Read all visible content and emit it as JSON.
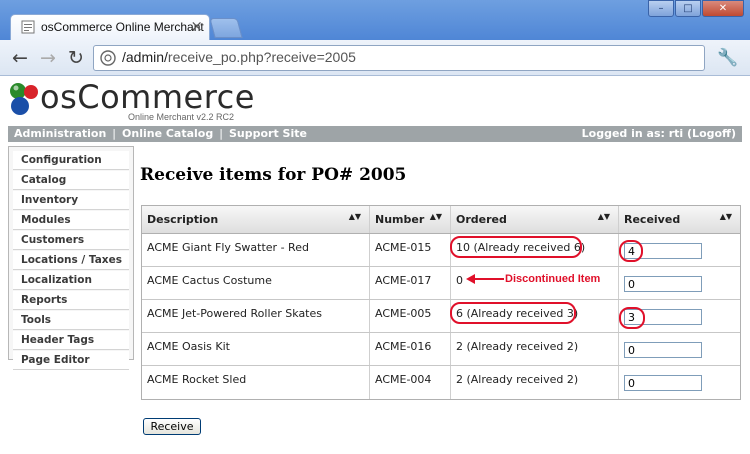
{
  "browser": {
    "tab_title": "osCommerce Online Merchant",
    "tab_close": "×",
    "url_prefix": "/admin/",
    "url_rest": "receive_po.php?receive=2005",
    "window_buttons": [
      "–",
      "□",
      "✕"
    ]
  },
  "header": {
    "brand": "osCommerce",
    "subtitle": "Online Merchant v2.2 RC2",
    "nav_links": [
      "Administration",
      "Online Catalog",
      "Support Site"
    ],
    "nav_separator": "|",
    "login_text": "Logged in as: rti (Logoff)"
  },
  "sidebar": {
    "items": [
      "Configuration",
      "Catalog",
      "Inventory",
      "Modules",
      "Customers",
      "Locations / Taxes",
      "Localization",
      "Reports",
      "Tools",
      "Header Tags",
      "Page Editor"
    ]
  },
  "main": {
    "title": "Receive items for PO# 2005",
    "columns": [
      "Description",
      "Number",
      "Ordered",
      "Received"
    ],
    "sort_glyph": "▲▼",
    "rows": [
      {
        "description": "ACME Giant Fly Swatter - Red",
        "number": "ACME-015",
        "ordered": "10 (Already received 6)",
        "received": "4"
      },
      {
        "description": "ACME Cactus Costume",
        "number": "ACME-017",
        "ordered": "0",
        "received": "0"
      },
      {
        "description": "ACME Jet-Powered Roller Skates",
        "number": "ACME-005",
        "ordered": "6 (Already received 3)",
        "received": "3"
      },
      {
        "description": "ACME Oasis Kit",
        "number": "ACME-016",
        "ordered": "2 (Already received 2)",
        "received": "0"
      },
      {
        "description": "ACME Rocket Sled",
        "number": "ACME-004",
        "ordered": "2 (Already received 2)",
        "received": "0"
      }
    ],
    "annotation": "Discontinued Item",
    "receive_button": "Receive"
  },
  "colors": {
    "annotation_red": "#e0102a",
    "navbar_gray": "#9ea4a7"
  }
}
